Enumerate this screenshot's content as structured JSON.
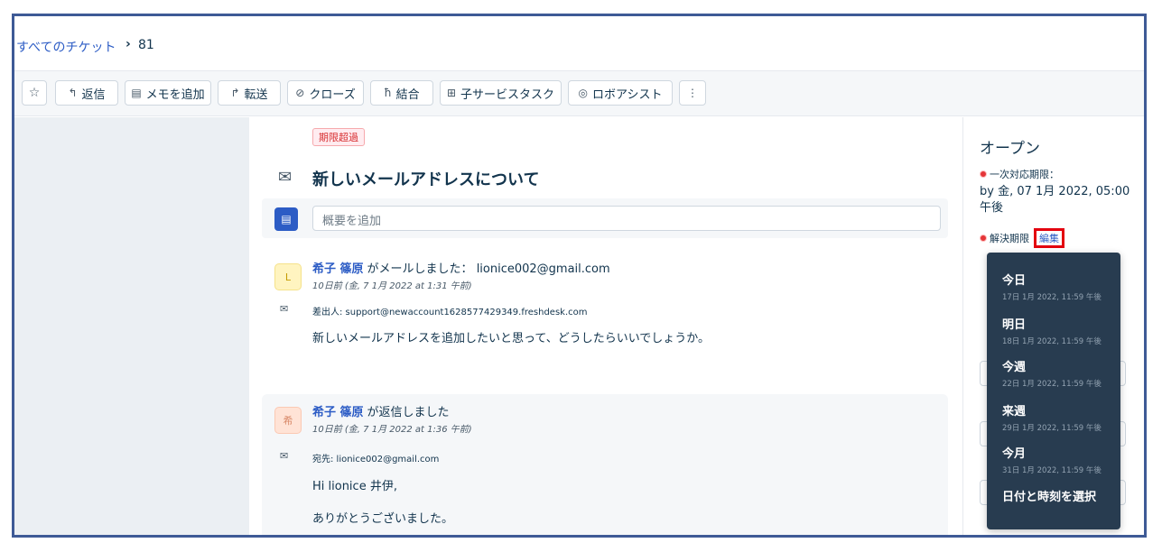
{
  "breadcrumb": {
    "all_tickets": "すべてのチケット",
    "separator": "›",
    "ticket_id": "81"
  },
  "toolbar": {
    "star_label": "☆",
    "reply_label": "返信",
    "note_label": "メモを追加",
    "forward_label": "転送",
    "close_label": "クローズ",
    "merge_label": "結合",
    "child_task_label": "子サービスタスク",
    "robo_label": "ロボアシスト",
    "more_label": "⋮"
  },
  "ticket": {
    "overdue_badge": "期限超過",
    "subject": "新しいメールアドレスについて",
    "summary_placeholder": "概要を追加"
  },
  "conversations": [
    {
      "avatar": "L",
      "author_name": "希子 篠原",
      "action": "がメールしました：",
      "email": "lionice002@gmail.com",
      "time": "10日前 (金, 7 1月 2022 at 1:31 午前)",
      "address": "差出人: support@newaccount1628577429349.freshdesk.com",
      "body": [
        "新しいメールアドレスを追加したいと思って、どうしたらいいでしょうか。"
      ]
    },
    {
      "avatar": "希",
      "author_name": "希子 篠原",
      "action": "が返信しました",
      "time": "10日前 (金, 7 1月 2022 at 1:36 午前)",
      "address": "宛先: lionice002@gmail.com",
      "body": [
        "Hi lionice 井伊,",
        "ありがとうございました。"
      ]
    }
  ],
  "sidebar": {
    "status": "オープン",
    "first_response_label": "一次対応期限：",
    "first_response_value": "by 金, 07 1月 2022, 05:00 午後",
    "resolution_label": "解決期限",
    "edit_label": "編集"
  },
  "due_dropdown": {
    "options": [
      {
        "label": "今日",
        "date": "17日 1月 2022, 11:59 午後"
      },
      {
        "label": "明日",
        "date": "18日 1月 2022, 11:59 午後"
      },
      {
        "label": "今週",
        "date": "22日 1月 2022, 11:59 午後"
      },
      {
        "label": "来週",
        "date": "29日 1月 2022, 11:59 午後"
      },
      {
        "label": "今月",
        "date": "31日 1月 2022, 11:59 午後"
      }
    ],
    "custom_label": "日付と時刻を選択"
  },
  "colors": {
    "link": "#2c5cc5",
    "dropdown_bg": "#283c50",
    "highlight_box": "#e3000f",
    "frame": "#3e5a96",
    "overdue": "#d72d30"
  }
}
